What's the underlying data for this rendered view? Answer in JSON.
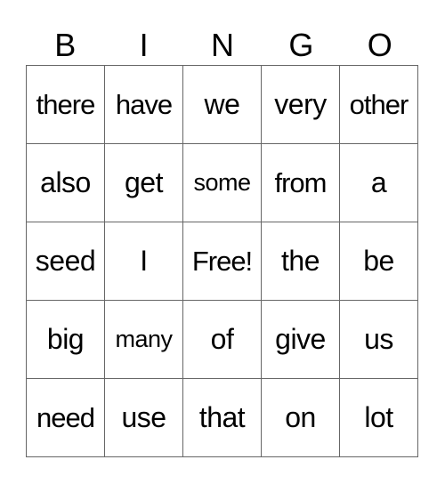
{
  "header": [
    "B",
    "I",
    "N",
    "G",
    "O"
  ],
  "rows": [
    [
      "there",
      "have",
      "we",
      "very",
      "other"
    ],
    [
      "also",
      "get",
      "some",
      "from",
      "a"
    ],
    [
      "seed",
      "I",
      "Free!",
      "the",
      "be"
    ],
    [
      "big",
      "many",
      "of",
      "give",
      "us"
    ],
    [
      "need",
      "use",
      "that",
      "on",
      "lot"
    ]
  ],
  "free_space": {
    "row": 2,
    "col": 2,
    "label": "Free!"
  }
}
